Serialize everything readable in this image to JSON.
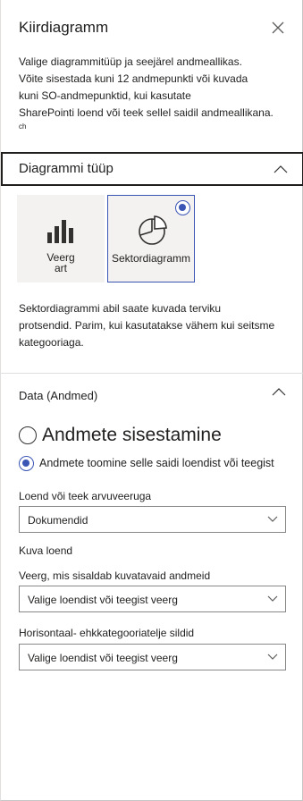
{
  "panel": {
    "title": "Kiirdiagramm",
    "close_icon": "close-icon"
  },
  "intro": {
    "line1": "Valige diagrammitüüp ja seejärel andmeallikas.",
    "line2": "Võite sisestada kuni 12 andmepunkti või kuvada",
    "line3": "kuni SO-andmepunktid, kui kasutate",
    "line4": "SharePointi loend või teek sellel saidil andmeallikana.",
    "line5": "ch"
  },
  "chart_type": {
    "header": "Diagrammi tüüp",
    "bar_label_1": "Veerg",
    "bar_label_2": "art",
    "pie_label": "Sektordiagramm",
    "selected": "pie",
    "bar_icon": "bar-chart-icon",
    "pie_icon": "pie-chart-icon",
    "accent": "#3b55b5"
  },
  "description": {
    "line1": "Sektordiagrammi abil saate kuvada terviku",
    "line2": "protsendid. Parim, kui kasutatakse vähem kui seitsme",
    "line3": "kategooriaga."
  },
  "data_section": {
    "header": "Data (Andmed)",
    "option_manual": "Andmete sisestamine",
    "option_list": "Andmete toomine selle saidi loendist või teegist",
    "selected": "list"
  },
  "fields": {
    "list_label": "Loend või teek arvuveeruga",
    "list_value": "Dokumendid",
    "show_list": "Kuva loend",
    "column_label": "Veerg, mis sisaldab kuvatavaid andmeid",
    "column_value": "Valige loendist või teegist veerg",
    "axis_label": "Horisontaal- ehkkategooriatelje sildid",
    "axis_value": "Valige loendist või teegist veerg"
  }
}
